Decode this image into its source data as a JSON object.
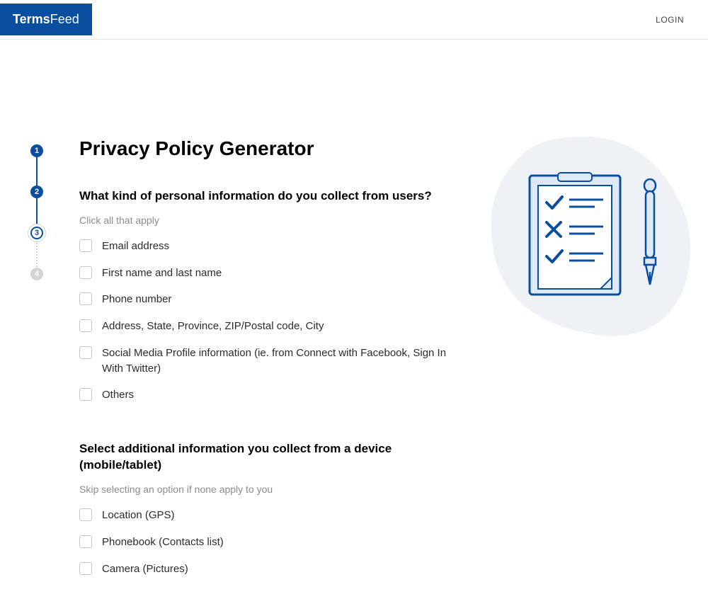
{
  "header": {
    "brand_pre": "Terms",
    "brand_post": "Feed",
    "login": "LOGIN"
  },
  "stepper": {
    "s1": "1",
    "s2": "2",
    "s3": "3",
    "s4": "4"
  },
  "main": {
    "title": "Privacy Policy Generator",
    "q1": "What kind of personal information do you collect from users?",
    "hint1": "Click all that apply",
    "opts1": {
      "o0": "Email address",
      "o1": "First name and last name",
      "o2": "Phone number",
      "o3": "Address, State, Province, ZIP/Postal code, City",
      "o4": "Social Media Profile information (ie. from Connect with Facebook, Sign In With Twitter)",
      "o5": "Others"
    },
    "q2": "Select additional information you collect from a device (mobile/tablet)",
    "hint2": "Skip selecting an option if none apply to you",
    "opts2": {
      "o0": "Location (GPS)",
      "o1": "Phonebook (Contacts list)",
      "o2": "Camera (Pictures)"
    }
  }
}
